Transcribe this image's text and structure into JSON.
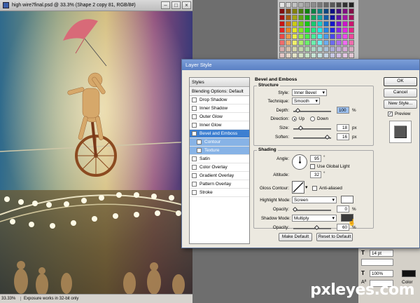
{
  "canvas": {
    "title": "high wire7final.psd @ 33.3% (Shape 2 copy 81, RGB/8#)",
    "zoom": "33.33%",
    "status": "Exposure works in 32-bit only"
  },
  "dialog": {
    "title": "Layer Style",
    "styles_header": "Styles",
    "blending_options": "Blending Options: Default",
    "style_items": [
      {
        "label": "Drop Shadow",
        "checked": false
      },
      {
        "label": "Inner Shadow",
        "checked": false
      },
      {
        "label": "Outer Glow",
        "checked": false
      },
      {
        "label": "Inner Glow",
        "checked": false
      },
      {
        "label": "Bevel and Emboss",
        "checked": true
      },
      {
        "label": "Contour",
        "checked": false
      },
      {
        "label": "Texture",
        "checked": false
      },
      {
        "label": "Satin",
        "checked": false
      },
      {
        "label": "Color Overlay",
        "checked": false
      },
      {
        "label": "Gradient Overlay",
        "checked": false
      },
      {
        "label": "Pattern Overlay",
        "checked": false
      },
      {
        "label": "Stroke",
        "checked": false
      }
    ],
    "bevel": {
      "section_title": "Bevel and Emboss",
      "structure_title": "Structure",
      "style_label": "Style:",
      "style_value": "Inner Bevel",
      "technique_label": "Technique:",
      "technique_value": "Smooth",
      "depth_label": "Depth:",
      "depth_value": "100",
      "depth_unit": "%",
      "direction_label": "Direction:",
      "dir_up": "Up",
      "dir_down": "Down",
      "size_label": "Size:",
      "size_value": "18",
      "size_unit": "px",
      "soften_label": "Soften:",
      "soften_value": "16",
      "soften_unit": "px"
    },
    "shading": {
      "title": "Shading",
      "angle_label": "Angle:",
      "angle_value": "95",
      "degree": "°",
      "global_light": "Use Global Light",
      "altitude_label": "Altitude:",
      "altitude_value": "32",
      "gloss_label": "Gloss Contour:",
      "anti_aliased": "Anti-aliased",
      "highlight_label": "Highlight Mode:",
      "highlight_value": "Screen",
      "hl_opacity_label": "Opacity:",
      "hl_opacity_value": "0",
      "shadow_label": "Shadow Mode:",
      "shadow_value": "Multiply",
      "sh_opacity_label": "Opacity:",
      "sh_opacity_value": "60",
      "percent": "%"
    },
    "make_default": "Make Default",
    "reset_default": "Reset to Default",
    "ok": "OK",
    "cancel": "Cancel",
    "new_style": "New Style...",
    "preview": "Preview"
  },
  "bottom_panel": {
    "size_value": "14 pt",
    "percent_value": "100%",
    "color_label": "Color"
  },
  "watermark": "pxleyes.com",
  "colors": {
    "selected_style": "#3d7fd1",
    "dialog_bg": "#ece9e0",
    "shadow_swatch": "#3a3a3a",
    "highlight_swatch": "#ffffff"
  }
}
